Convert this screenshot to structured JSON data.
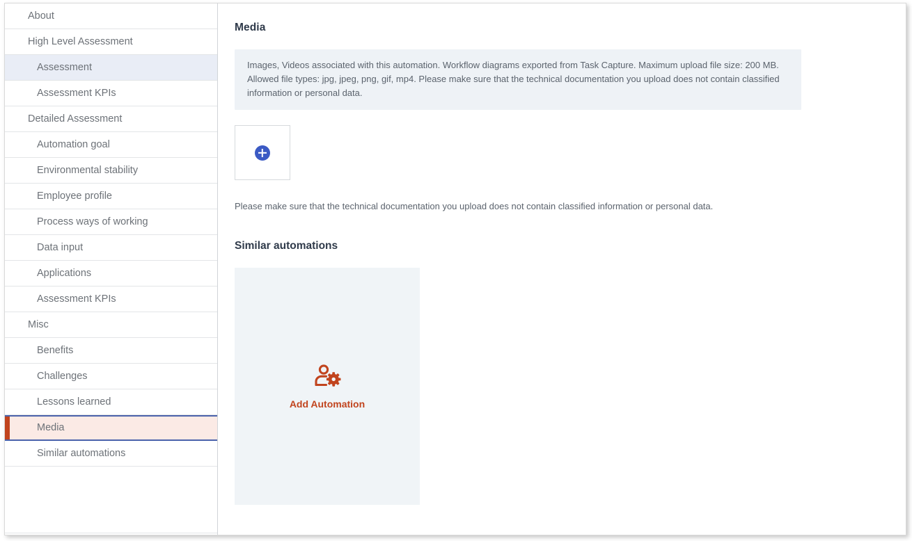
{
  "sidebar": {
    "items": [
      {
        "label": "About",
        "level": 0,
        "state": "normal"
      },
      {
        "label": "High Level Assessment",
        "level": 0,
        "state": "normal"
      },
      {
        "label": "Assessment",
        "level": 1,
        "state": "selected-soft"
      },
      {
        "label": "Assessment KPIs",
        "level": 1,
        "state": "normal"
      },
      {
        "label": "Detailed Assessment",
        "level": 0,
        "state": "normal"
      },
      {
        "label": "Automation goal",
        "level": 1,
        "state": "normal"
      },
      {
        "label": "Environmental stability",
        "level": 1,
        "state": "normal"
      },
      {
        "label": "Employee profile",
        "level": 1,
        "state": "normal"
      },
      {
        "label": "Process ways of working",
        "level": 1,
        "state": "normal"
      },
      {
        "label": "Data input",
        "level": 1,
        "state": "normal"
      },
      {
        "label": "Applications",
        "level": 1,
        "state": "normal"
      },
      {
        "label": "Assessment KPIs",
        "level": 1,
        "state": "normal"
      },
      {
        "label": "Misc",
        "level": 0,
        "state": "normal"
      },
      {
        "label": "Benefits",
        "level": 1,
        "state": "normal"
      },
      {
        "label": "Challenges",
        "level": 1,
        "state": "normal"
      },
      {
        "label": "Lessons learned",
        "level": 1,
        "state": "normal"
      },
      {
        "label": "Media",
        "level": 1,
        "state": "selected-active"
      },
      {
        "label": "Similar automations",
        "level": 1,
        "state": "normal"
      }
    ]
  },
  "main": {
    "page_title": "Media",
    "info_box": "Images, Videos associated with this automation. Workflow diagrams exported from Task Capture. Maximum upload file size: 200 MB. Allowed file types: jpg, jpeg, png, gif, mp4. Please make sure that the technical documentation you upload does not contain classified information or personal data.",
    "upload_tile": {
      "icon": "plus-circle-icon"
    },
    "disclaimer": "Please make sure that the technical documentation you upload does not contain classified information or personal data.",
    "similar_automations": {
      "section_title": "Similar automations",
      "add_card": {
        "icon": "person-gear-icon",
        "label": "Add Automation"
      }
    }
  },
  "colors": {
    "accent_orange": "#c1441e",
    "accent_blue": "#3b5ac4",
    "selected_border_blue": "#4a62ab",
    "selected_active_bg": "#fbeae5",
    "selected_soft_bg": "#e9edf6",
    "info_box_bg": "#eef2f6",
    "card_bg": "#f0f4f7",
    "heading_text": "#2f3a4a",
    "body_text": "#5b636d",
    "nav_text": "#6d7278"
  }
}
